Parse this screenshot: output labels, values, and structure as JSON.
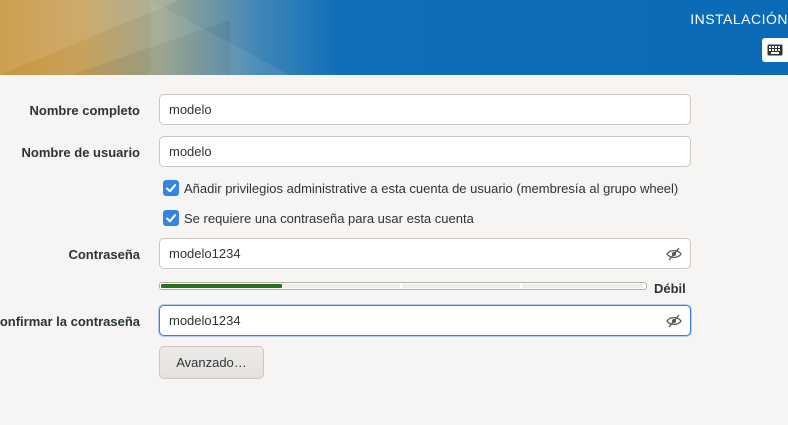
{
  "header": {
    "title": "INSTALACIÓN",
    "keyboard_icon": "keyboard-icon",
    "colors": {
      "accent": "#0b6ab6",
      "art": "#c8963e"
    }
  },
  "form": {
    "fullname": {
      "label": "Nombre completo",
      "value": "modelo"
    },
    "username": {
      "label": "Nombre de usuario",
      "value": "modelo"
    },
    "admin_checkbox": {
      "label": "Añadir privilegios administrative a esta cuenta de usuario (membresía al grupo wheel)",
      "checked": true
    },
    "require_password_checkbox": {
      "label": "Se requiere una contraseña para usar esta cuenta",
      "checked": true
    },
    "password": {
      "label": "Contraseña",
      "value": "modelo1234",
      "reveal_icon": "eye-slash-icon"
    },
    "strength": {
      "text": "Débil",
      "level": 0.25,
      "color": "#26701e"
    },
    "confirm": {
      "label": "Confirmar la contraseña",
      "value": "modelo1234",
      "reveal_icon": "eye-slash-icon"
    },
    "advanced_button": "Avanzado…"
  }
}
